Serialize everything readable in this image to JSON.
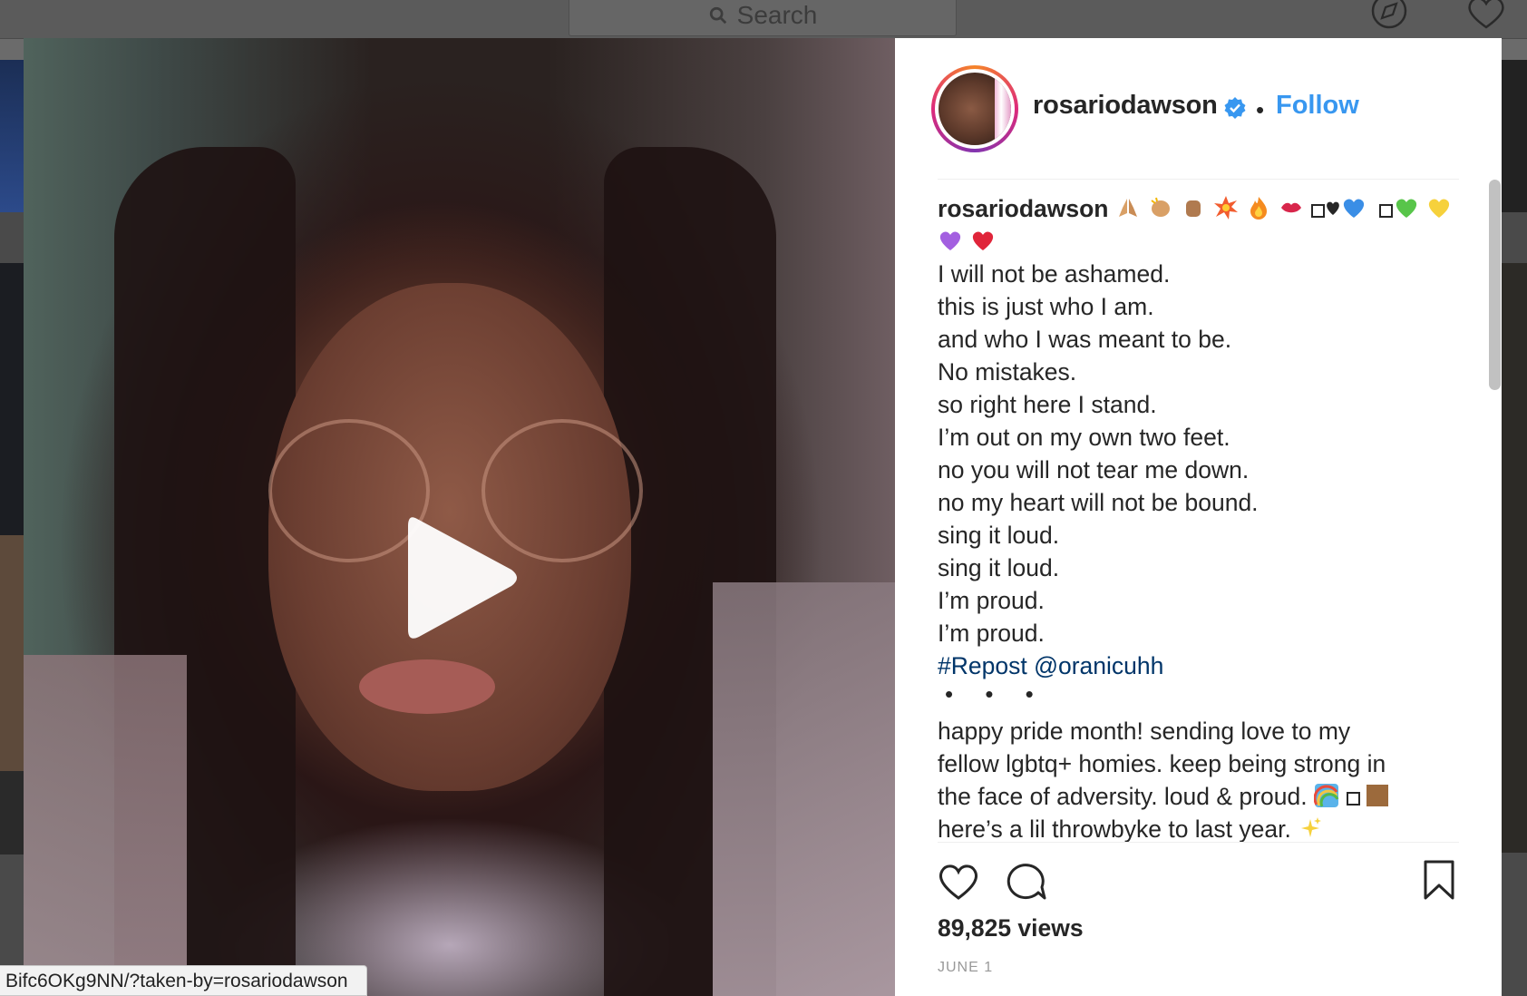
{
  "top_bar": {
    "search_placeholder": "Search",
    "icons": [
      "search-icon",
      "explore-compass-icon",
      "activity-heart-icon"
    ]
  },
  "video": {
    "play_icon": "play-icon",
    "status_url": "Bifc6OKg9NN/?taken-by=rosariodawson"
  },
  "post": {
    "username": "rosariodawson",
    "verified_icon": "verified-badge-icon",
    "separator": "•",
    "follow_label": "Follow",
    "caption": {
      "username": "rosariodawson",
      "lines": [
        "I will not be ashamed.",
        "this is just who I am.",
        "and who I was meant to be.",
        "No mistakes.",
        "so right here I stand.",
        "I’m out on my own two feet.",
        "no you will not tear me down.",
        "no my heart will not be bound.",
        "sing it loud.",
        "sing it loud.",
        "I’m proud.",
        "I’m proud."
      ],
      "hashtag": "#Repost",
      "mention": "@oranicuhh",
      "dots": "• • •",
      "paragraph_lines": [
        "happy pride month! sending love to my",
        "fellow lgbtq+ homies. keep being strong in",
        "the face of adversity. loud & proud.",
        "here’s a lil throwbyke to last year."
      ]
    },
    "views": "89,825 views",
    "date": "JUNE 1"
  },
  "colors": {
    "link_blue": "#3897f0",
    "hashtag_blue": "#003569",
    "text": "#262626"
  }
}
